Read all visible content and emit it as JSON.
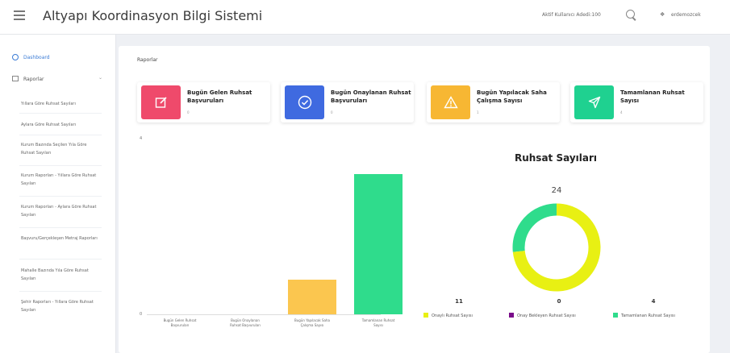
{
  "header": {
    "title": "Altyapı Koordinasyon Bilgi Sistemi",
    "active_users": "Aktif Kullanıcı Adedi:100",
    "username": "erdemozcek"
  },
  "sidebar": {
    "dashboard_label": "Dashboard",
    "reports_label": "Raporlar",
    "items": [
      {
        "label": "Yıllara Göre Ruhsat Sayıları"
      },
      {
        "label": "Aylara Göre Ruhsat Sayıları"
      },
      {
        "label": "Kurum Bazında Seçilen Yıla Göre Ruhsat Sayıları"
      },
      {
        "label": "Kurum Raporları - Yıllara Göre Ruhsat Sayıları"
      },
      {
        "label": "Kurum Raporları - Aylara Göre Ruhsat Sayıları"
      },
      {
        "label": "Başvuru/Gerçekleşen Metraj Raporları"
      },
      {
        "label": "Mahalle Bazında Yıla Göre Ruhsat Sayıları"
      },
      {
        "label": "Şehir Raporları - Yıllara Göre Ruhsat Sayıları"
      }
    ]
  },
  "main": {
    "title": "Raporlar",
    "cards": [
      {
        "label": "Bugün Gelen Ruhsat Başvuruları",
        "count": "0",
        "color": "#ef4a6b",
        "icon": "edit-icon"
      },
      {
        "label": "Bugün Onaylanan Ruhsat Başvuruları",
        "count": "0",
        "color": "#3f6ae0",
        "icon": "check-circle-icon"
      },
      {
        "label": "Bugün Yapılacak Saha Çalışma Sayısı",
        "count": "1",
        "color": "#f7b733",
        "icon": "warning-icon"
      },
      {
        "label": "Tamamlanan Ruhsat Sayısı",
        "count": "4",
        "color": "#1fd190",
        "icon": "send-icon"
      }
    ]
  },
  "chart_data": [
    {
      "type": "bar",
      "categories": [
        "Bugün Gelen Ruhsat Başvuruları",
        "Bugün Onaylanan Ruhsat Başvuruları",
        "Bugün Yapılacak Saha Çalışma Sayısı",
        "Tamamlanan Ruhsat Sayısı"
      ],
      "values": [
        0,
        0,
        1,
        4
      ],
      "colors": [
        "#ef4a6b",
        "#3f6ae0",
        "#fbc64f",
        "#2fdc8c"
      ],
      "y_ticks": [
        "0",
        "4"
      ],
      "ylim": [
        0,
        4
      ]
    },
    {
      "type": "pie",
      "title": "Ruhsat Sayıları",
      "total_label": "24",
      "labels": [
        "Onaylı Ruhsat Sayısı",
        "Onay Bekleyen Ruhsat Sayısı",
        "Tamamlanan Ruhsat Sayısı"
      ],
      "values": [
        11,
        0,
        4
      ],
      "value_labels": [
        "11",
        "0",
        "4"
      ],
      "colors": [
        "#e8f013",
        "#7a0d8a",
        "#2fdc8c"
      ]
    }
  ]
}
